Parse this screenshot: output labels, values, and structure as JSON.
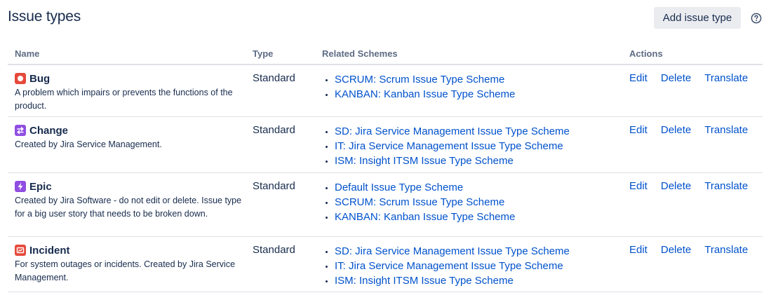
{
  "header": {
    "title": "Issue types",
    "add_button_label": "Add issue type",
    "help_icon": "question-circle-icon"
  },
  "columns": {
    "name": "Name",
    "type": "Type",
    "schemes": "Related Schemes",
    "actions": "Actions"
  },
  "colors": {
    "link": "#0052cc",
    "text": "#172b4d",
    "muted": "#5e6c84",
    "bug": "#e5493a",
    "change": "#904ee2",
    "epic": "#904ee2",
    "incident": "#e5493a"
  },
  "rows": [
    {
      "name": "Bug",
      "icon": "bug-icon",
      "description": "A problem which impairs or prevents the functions of the product.",
      "type": "Standard",
      "schemes": [
        "SCRUM: Scrum Issue Type Scheme",
        "KANBAN: Kanban Issue Type Scheme"
      ],
      "actions": {
        "edit": "Edit",
        "delete": "Delete",
        "translate": "Translate"
      }
    },
    {
      "name": "Change",
      "icon": "change-icon",
      "description": "Created by Jira Service Management.",
      "type": "Standard",
      "schemes": [
        "SD: Jira Service Management Issue Type Scheme",
        "IT: Jira Service Management Issue Type Scheme",
        "ISM: Insight ITSM Issue Type Scheme"
      ],
      "actions": {
        "edit": "Edit",
        "delete": "Delete",
        "translate": "Translate"
      }
    },
    {
      "name": "Epic",
      "icon": "epic-lightning-icon",
      "description": "Created by Jira Software - do not edit or delete. Issue type for a big user story that needs to be broken down.",
      "type": "Standard",
      "schemes": [
        "Default Issue Type Scheme",
        "SCRUM: Scrum Issue Type Scheme",
        "KANBAN: Kanban Issue Type Scheme"
      ],
      "actions": {
        "edit": "Edit",
        "delete": "Delete",
        "translate": "Translate"
      }
    },
    {
      "name": "Incident",
      "icon": "incident-icon",
      "description": "For system outages or incidents. Created by Jira Service Management.",
      "type": "Standard",
      "schemes": [
        "SD: Jira Service Management Issue Type Scheme",
        "IT: Jira Service Management Issue Type Scheme",
        "ISM: Insight ITSM Issue Type Scheme"
      ],
      "actions": {
        "edit": "Edit",
        "delete": "Delete",
        "translate": "Translate"
      }
    }
  ]
}
